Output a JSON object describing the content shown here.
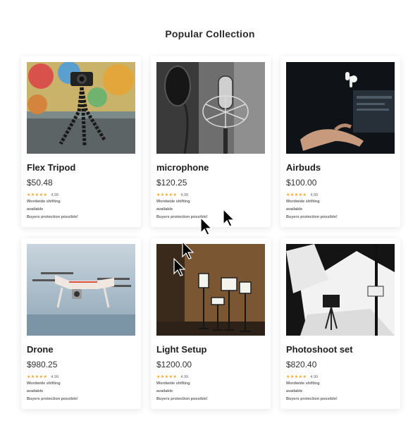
{
  "section": {
    "title": "Popular Collection"
  },
  "products": [
    {
      "name": "Flex Tripod",
      "price": "$50.48",
      "stars": "★★★★★",
      "rating": "4.99",
      "shipping": "Wordwide shifting",
      "availability": "available",
      "protection": "Buyers protection possible!",
      "icon": "tripod-photo"
    },
    {
      "name": "microphone",
      "price": "$120.25",
      "stars": "★★★★★",
      "rating": "4.99",
      "shipping": "Wordwide shifting",
      "availability": "available",
      "protection": "Buyers protection possible!",
      "icon": "microphone-photo"
    },
    {
      "name": "Airbuds",
      "price": "$100.00",
      "stars": "★★★★★",
      "rating": "4.99",
      "shipping": "Wordwide shifting",
      "availability": "available",
      "protection": "Buyers protection possible!",
      "icon": "airbuds-photo"
    },
    {
      "name": "Drone",
      "price": "$980.25",
      "stars": "★★★★★",
      "rating": "4.99",
      "shipping": "Wordwide shifting",
      "availability": "available",
      "protection": "Buyers protection possible!",
      "icon": "drone-photo"
    },
    {
      "name": "Light Setup",
      "price": "$1200.00",
      "stars": "★★★★★",
      "rating": "4.99",
      "shipping": "Wordwide shifting",
      "availability": "available",
      "protection": "Buyers protection possible!",
      "icon": "light-setup-photo"
    },
    {
      "name": "Photoshoot set",
      "price": "$820.40",
      "stars": "★★★★★",
      "rating": "4.99",
      "shipping": "Wordwide shifting",
      "availability": "available",
      "protection": "Buyers protection possible!",
      "icon": "photoshoot-set-photo"
    }
  ],
  "colors": {
    "accent_star": "#f3a521",
    "text": "#222222",
    "background": "#ffffff"
  }
}
